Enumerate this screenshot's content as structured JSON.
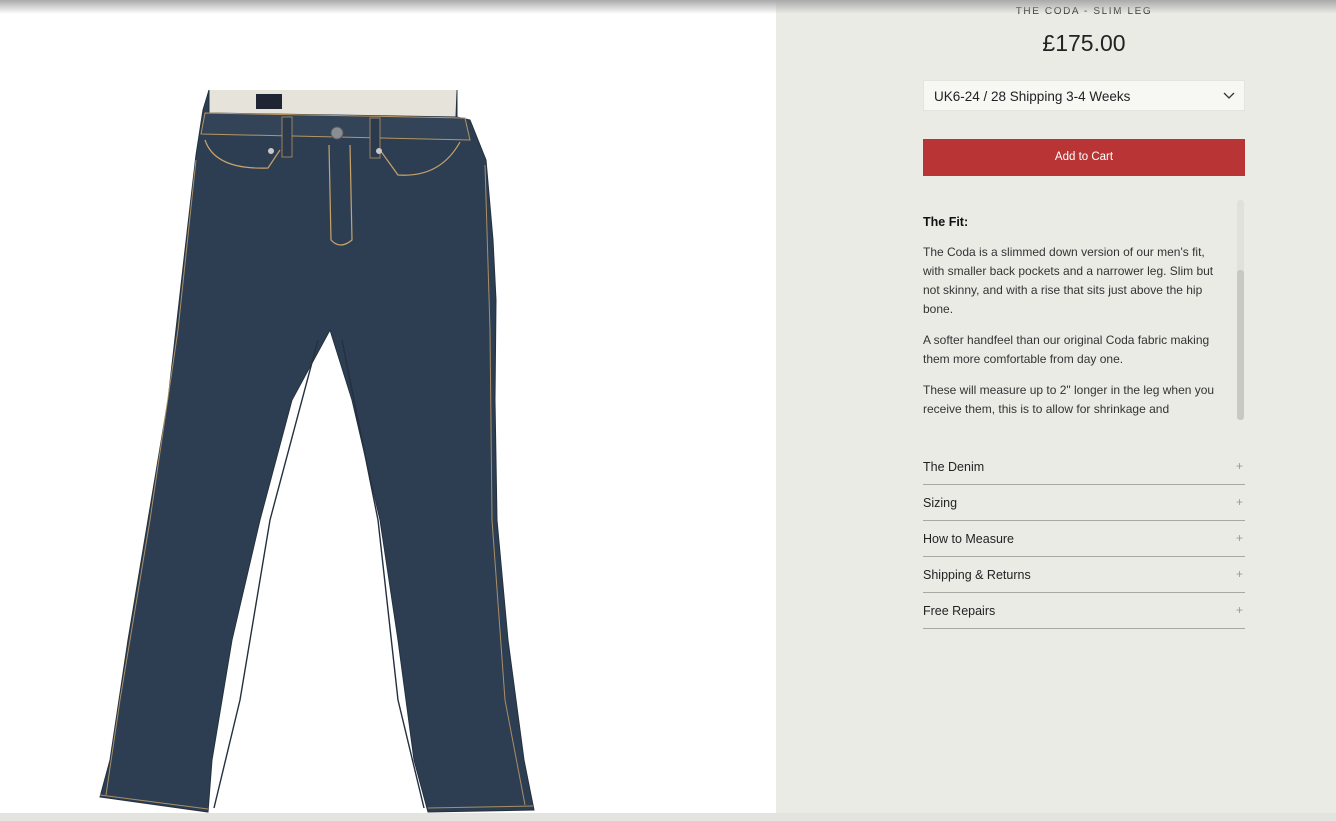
{
  "product": {
    "title": "THE CODA - SLIM LEG",
    "price": "£175.00"
  },
  "variant": {
    "selected": "UK6-24 / 28 Shipping 3-4 Weeks"
  },
  "cart": {
    "label": "Add to Cart"
  },
  "description": {
    "heading": "The Fit:",
    "paragraphs": [
      "The Coda is a slimmed down version of our men's fit, with smaller back pockets and a narrower leg. Slim but not skinny, and with a rise that sits just above the hip bone.",
      "A softer handfeel than our original Coda fabric making them more comfortable from day one.",
      "These will measure up to 2\" longer in the leg when you receive them, this is to allow for shrinkage and"
    ]
  },
  "accordion": [
    {
      "label": "The Denim",
      "icon": "plus-icon"
    },
    {
      "label": "Sizing",
      "icon": "plus-icon"
    },
    {
      "label": "How to Measure",
      "icon": "plus-icon"
    },
    {
      "label": "Shipping & Returns",
      "icon": "plus-icon"
    },
    {
      "label": "Free Repairs",
      "icon": "plus-icon"
    }
  ],
  "icons": {
    "select": "chevron-down-icon",
    "accordion": "plus-icon"
  },
  "colors": {
    "accent": "#b93535",
    "panel": "#ebebe6",
    "denim": "#2e3e52",
    "stitch": "#c8a36a"
  }
}
